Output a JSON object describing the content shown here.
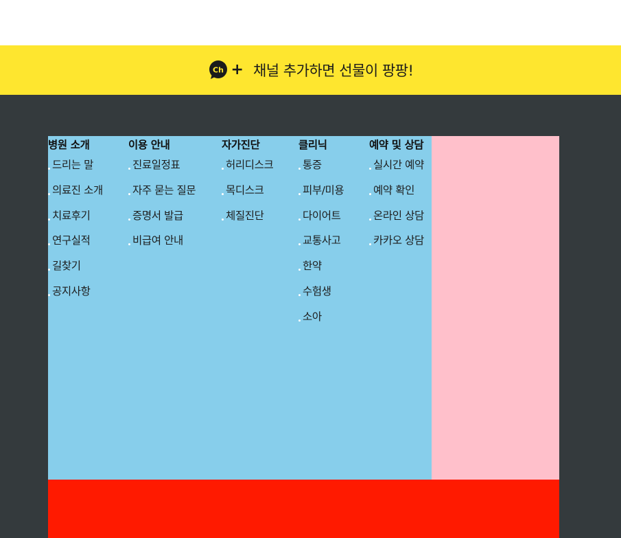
{
  "banner": {
    "ch_badge": "Ch",
    "plus": "+",
    "text": "채널 추가하면 선물이 팡팡!"
  },
  "colors": {
    "banner_bg": "#fee62f",
    "dark_bg": "#343a3d",
    "menu_bg": "#87ceeb",
    "side_bg": "#ffc0cb",
    "bottom_bg": "#ff1a00"
  },
  "menu": [
    {
      "title": "병원 소개",
      "items": [
        "드리는 말",
        "의료진 소개",
        "치료후기",
        "연구실적",
        "길찾기",
        "공지사항"
      ]
    },
    {
      "title": "이용 안내",
      "items": [
        "진료일정표",
        "자주 묻는 질문",
        "증명서 발급",
        "비급여 안내"
      ]
    },
    {
      "title": "자가진단",
      "items": [
        "허리디스크",
        "목디스크",
        "체질진단"
      ]
    },
    {
      "title": "클리닉",
      "items": [
        "통증",
        "피부/미용",
        "다이어트",
        "교통사고",
        "한약",
        "수험생",
        "소아"
      ]
    },
    {
      "title": "예약 및 상담",
      "items": [
        "실시간 예약",
        "예약 확인",
        "온라인 상담",
        "카카오 상담"
      ]
    }
  ]
}
